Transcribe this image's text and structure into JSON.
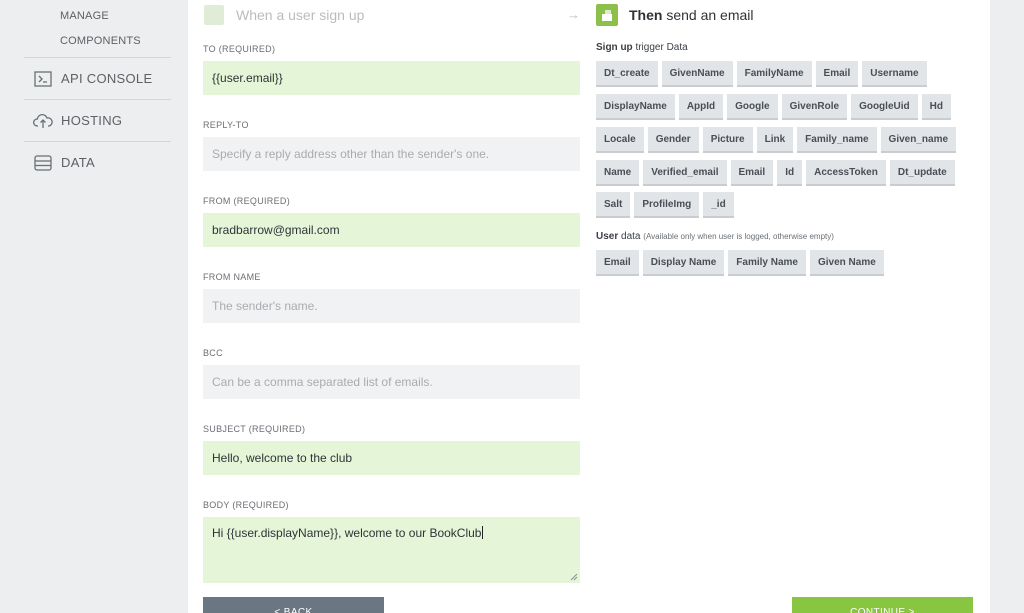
{
  "sidebar": {
    "sub_items": [
      {
        "label": "MANAGE"
      },
      {
        "label": "COMPONENTS"
      }
    ],
    "items": [
      {
        "label": "API CONSOLE",
        "icon": "terminal-icon"
      },
      {
        "label": "HOSTING",
        "icon": "cloud-upload-icon"
      },
      {
        "label": "DATA",
        "icon": "database-icon"
      }
    ]
  },
  "trigger_step": {
    "title": "When a user sign up"
  },
  "form": {
    "fields": [
      {
        "label": "TO (REQUIRED)",
        "value": "{{user.email}}",
        "placeholder": ""
      },
      {
        "label": "REPLY-TO",
        "value": "",
        "placeholder": "Specify a reply address other than the sender's one."
      },
      {
        "label": "FROM (REQUIRED)",
        "value": "bradbarrow@gmail.com",
        "placeholder": ""
      },
      {
        "label": "FROM NAME",
        "value": "",
        "placeholder": "The sender's name."
      },
      {
        "label": "BCC",
        "value": "",
        "placeholder": "Can be a comma separated list of emails."
      },
      {
        "label": "SUBJECT (REQUIRED)",
        "value": "Hello, welcome to the club",
        "placeholder": ""
      },
      {
        "label": "BODY (REQUIRED)",
        "value": "Hi {{user.displayName}}, welcome to our BookClub",
        "placeholder": ""
      }
    ],
    "back_label": "< BACK",
    "continue_label": "CONTINUE >"
  },
  "action_step": {
    "title_bold": "Then",
    "title_rest": " send an email",
    "trigger_data": {
      "title_bold": "Sign up",
      "title_rest": " trigger Data",
      "chip_rows": [
        [
          "Dt_create",
          "GivenName",
          "FamilyName",
          "Email",
          "Username"
        ],
        [
          "DisplayName",
          "AppId",
          "Google",
          "GivenRole",
          "GoogleUid",
          "Hd"
        ],
        [
          "Locale",
          "Gender",
          "Picture",
          "Link",
          "Family_name",
          "Given_name"
        ],
        [
          "Name",
          "Verified_email",
          "Email",
          "Id",
          "AccessToken",
          "Dt_update"
        ],
        [
          "Salt",
          "ProfileImg",
          "_id"
        ]
      ]
    },
    "user_data": {
      "title_bold": "User",
      "title_rest": " data",
      "note": "(Available only when user is logged, otherwise empty)",
      "chips": [
        "Email",
        "Display Name",
        "Family Name",
        "Given Name"
      ]
    }
  },
  "colors": {
    "filled_field": "#e5f6d8",
    "empty_field": "#f1f2f3",
    "accent_green": "#88c541",
    "back_button": "#6b7683"
  }
}
